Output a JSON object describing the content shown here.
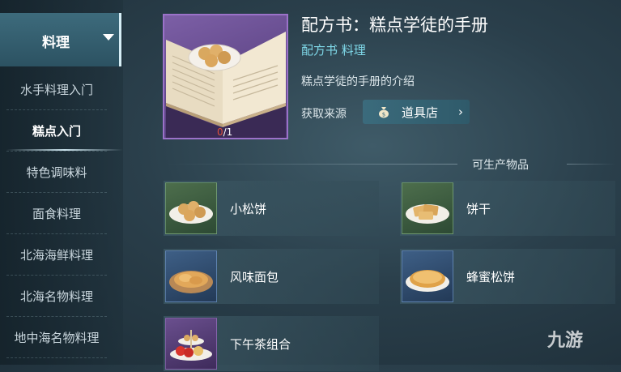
{
  "sidebar": {
    "header_label": "料理",
    "items": [
      {
        "label": "水手料理入门",
        "active": false
      },
      {
        "label": "糕点入门",
        "active": true
      },
      {
        "label": "特色调味料",
        "active": false
      },
      {
        "label": "面食料理",
        "active": false
      },
      {
        "label": "北海海鲜料理",
        "active": false
      },
      {
        "label": "北海名物料理",
        "active": false
      },
      {
        "label": "地中海名物料理",
        "active": false
      }
    ]
  },
  "recipe": {
    "title": "配方书：糕点学徒的手册",
    "subtitle": "配方书 料理",
    "description": "糕点学徒的手册的介绍",
    "owned_count": "0",
    "count_separator": "/1",
    "source_label": "获取来源",
    "source_button": "道具店"
  },
  "products": {
    "title": "可生产物品",
    "items": [
      {
        "name": "小松饼",
        "rarity": "green",
        "icon": "muffins-icon"
      },
      {
        "name": "饼干",
        "rarity": "green",
        "icon": "biscuits-icon"
      },
      {
        "name": "风味面包",
        "rarity": "blue",
        "icon": "bread-icon"
      },
      {
        "name": "蜂蜜松饼",
        "rarity": "blue",
        "icon": "honey-pancake-icon"
      },
      {
        "name": "下午茶组合",
        "rarity": "purple",
        "icon": "afternoon-tea-icon"
      }
    ]
  },
  "watermark": "九游",
  "colors": {
    "accent_cyan": "#7fd8e8",
    "count_zero": "#e0523c",
    "rarity_green": "#4d6e4c",
    "rarity_blue": "#3e5f86",
    "rarity_purple": "#6a4f8e"
  }
}
